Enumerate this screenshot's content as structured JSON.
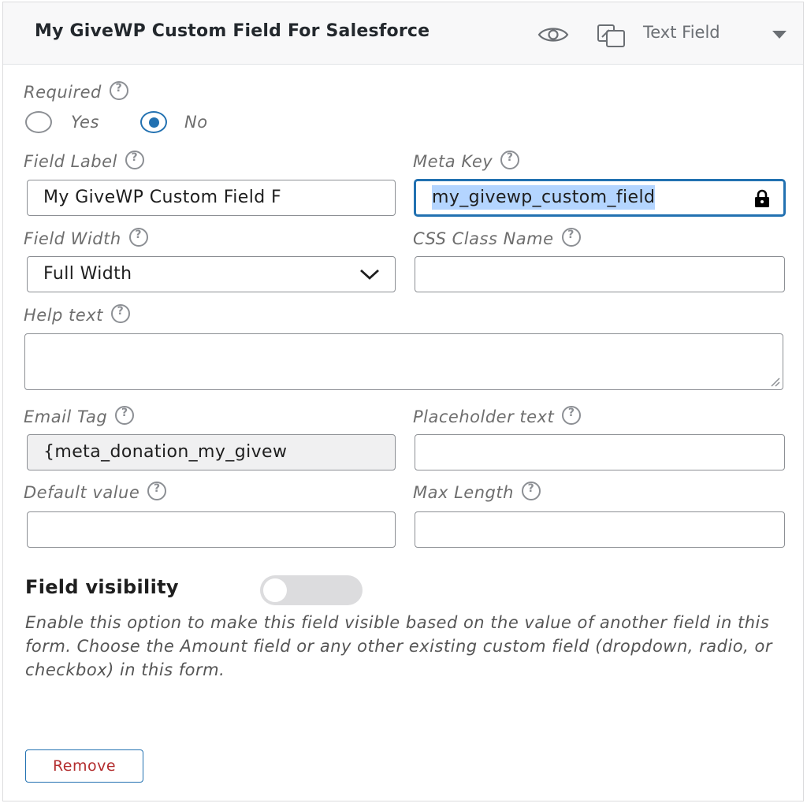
{
  "header": {
    "title": "My GiveWP Custom Field For Salesforce",
    "field_type": "Text Field",
    "icons": [
      "eye-icon",
      "copy-icon",
      "caret-down-icon"
    ]
  },
  "required": {
    "label": "Required",
    "options": [
      {
        "label": "Yes",
        "checked": false
      },
      {
        "label": "No",
        "checked": true
      }
    ]
  },
  "field_label": {
    "label": "Field Label",
    "value": "My GiveWP Custom Field F"
  },
  "meta_key": {
    "label": "Meta Key",
    "value": "my_givewp_custom_field",
    "locked": true
  },
  "field_width": {
    "label": "Field Width",
    "value": "Full Width"
  },
  "css_class": {
    "label": "CSS Class Name",
    "value": ""
  },
  "help_text": {
    "label": "Help text",
    "value": ""
  },
  "email_tag": {
    "label": "Email Tag",
    "value": "{meta_donation_my_givew"
  },
  "placeholder_text": {
    "label": "Placeholder text",
    "value": ""
  },
  "default_value": {
    "label": "Default value",
    "value": ""
  },
  "max_length": {
    "label": "Max Length",
    "value": ""
  },
  "visibility": {
    "title": "Field visibility",
    "enabled": false,
    "description": "Enable this option to make this field visible based on the value of another field in this form. Choose the Amount field or any other existing custom field (dropdown, radio, or checkbox) in this form."
  },
  "remove_label": "Remove",
  "colors": {
    "accent": "#2271b1",
    "danger": "#b32d2e",
    "selection": "#b4d5ff"
  }
}
